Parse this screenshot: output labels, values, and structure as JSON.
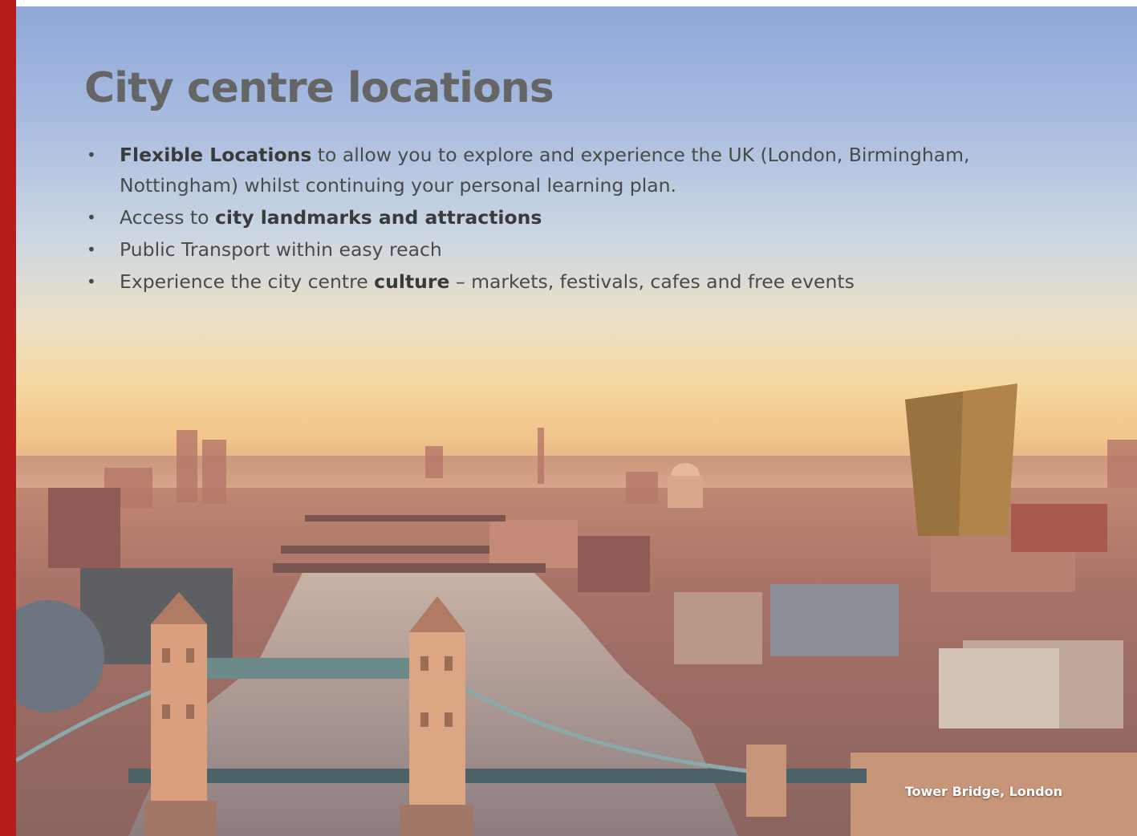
{
  "slide": {
    "title": "City centre locations",
    "bullets": [
      {
        "bold": "Flexible Locations",
        "rest": " to allow you to explore and experience the UK (London, Birmingham, Nottingham) whilst continuing your personal learning plan."
      },
      {
        "pre": "Access to ",
        "bold": "city landmarks and attractions"
      },
      {
        "pre": "Public Transport within easy reach"
      },
      {
        "pre": "Experience the city centre ",
        "bold": "culture",
        "rest": " – markets, festivals, cafes and free events"
      }
    ],
    "bullet_glyph": "•",
    "caption": "Tower Bridge, London"
  },
  "colors": {
    "accent": "#b71c1c",
    "title": "#656565",
    "body_text": "#4a4a4a",
    "caption": "#ffffff"
  }
}
